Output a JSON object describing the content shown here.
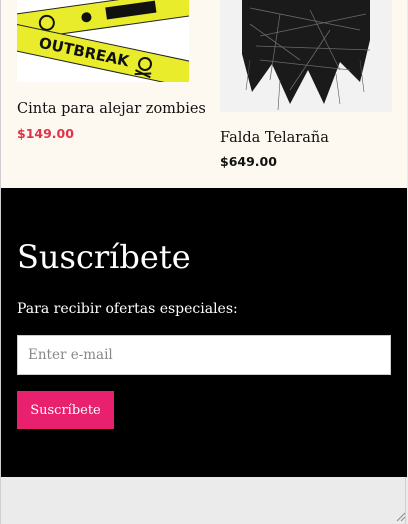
{
  "products": [
    {
      "name": "Cinta para alejar zombies",
      "price": "$149.00",
      "image_text": "OUTBREAK",
      "image_icon": "biohazard-icon"
    },
    {
      "name": "Falda Telaraña",
      "price": "$649.00",
      "image_icon": "spiderweb-skirt-icon"
    }
  ],
  "subscribe": {
    "title": "Suscríbete",
    "description": "Para recibir ofertas especiales:",
    "email_placeholder": "Enter e-mail",
    "email_value": "",
    "button_label": "Suscríbete"
  },
  "colors": {
    "accent": "#e8206d",
    "price_1": "#e2324a",
    "price_2": "#111111",
    "footer_bg": "#000000",
    "products_bg": "#fdf8f0"
  }
}
